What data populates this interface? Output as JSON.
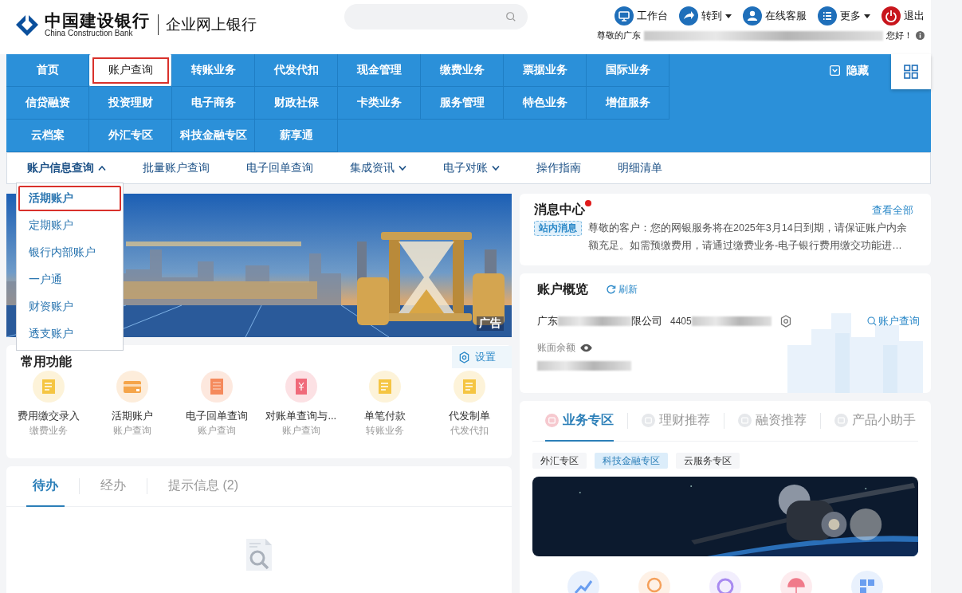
{
  "header": {
    "logo_cn": "中国建设银行",
    "logo_en": "China Construction Bank",
    "product": "企业网上银行",
    "toolbar": [
      {
        "label": "工作台",
        "kind": "monitor",
        "dropdown": false
      },
      {
        "label": "转到",
        "kind": "forward",
        "dropdown": true
      },
      {
        "label": "在线客服",
        "kind": "person",
        "dropdown": false
      },
      {
        "label": "更多",
        "kind": "list",
        "dropdown": true
      },
      {
        "label": "退出",
        "kind": "power",
        "dropdown": false
      }
    ],
    "greeting": {
      "prefix": "尊敬的广东",
      "suffix": "您好！"
    }
  },
  "main_nav": {
    "rows": [
      {
        "items": [
          {
            "label": "首页",
            "selected": false
          },
          {
            "label": "账户查询",
            "selected": true
          },
          {
            "label": "转账业务",
            "selected": false
          },
          {
            "label": "代发代扣",
            "selected": false
          },
          {
            "label": "现金管理",
            "selected": false
          },
          {
            "label": "缴费业务",
            "selected": false
          },
          {
            "label": "票据业务",
            "selected": false
          },
          {
            "label": "国际业务",
            "selected": false
          }
        ]
      },
      {
        "items": [
          {
            "label": "信贷融资",
            "selected": false
          },
          {
            "label": "投资理财",
            "selected": false
          },
          {
            "label": "电子商务",
            "selected": false
          },
          {
            "label": "财政社保",
            "selected": false
          },
          {
            "label": "卡类业务",
            "selected": false
          },
          {
            "label": "服务管理",
            "selected": false
          },
          {
            "label": "特色业务",
            "selected": false
          },
          {
            "label": "增值服务",
            "selected": false
          }
        ]
      },
      {
        "items": [
          {
            "label": "云档案",
            "selected": false
          },
          {
            "label": "外汇专区",
            "selected": false
          },
          {
            "label": "科技金融专区",
            "selected": false
          },
          {
            "label": "薪享通",
            "selected": false
          }
        ]
      }
    ],
    "hide_label": "隐藏"
  },
  "sub_nav": [
    {
      "label": "账户信息查询",
      "dropdown": true,
      "expanded": true
    },
    {
      "label": "批量账户查询",
      "dropdown": false
    },
    {
      "label": "电子回单查询",
      "dropdown": false
    },
    {
      "label": "集成资讯",
      "dropdown": true,
      "expanded": false
    },
    {
      "label": "电子对账",
      "dropdown": true,
      "expanded": false
    },
    {
      "label": "操作指南",
      "dropdown": false
    },
    {
      "label": "明细清单",
      "dropdown": false
    }
  ],
  "dropdown_menu": [
    {
      "label": "活期账户",
      "selected": true
    },
    {
      "label": "定期账户",
      "selected": false
    },
    {
      "label": "银行内部账户",
      "selected": false
    },
    {
      "label": "一户通",
      "selected": false
    },
    {
      "label": "财资账户",
      "selected": false
    },
    {
      "label": "透支账户",
      "selected": false
    }
  ],
  "banner": {
    "kind": "picture",
    "ad_label": "广告"
  },
  "common_functions": {
    "title": "常用功能",
    "settings_label": "设置",
    "items": [
      {
        "label": "费用缴交录入",
        "category": "缴费业务",
        "kind": "doc"
      },
      {
        "label": "活期账户",
        "category": "账户查询",
        "kind": "card"
      },
      {
        "label": "电子回单查询",
        "category": "账户查询",
        "kind": "receipt"
      },
      {
        "label": "对账单查询与...",
        "category": "账户查询",
        "kind": "bill"
      },
      {
        "label": "单笔付款",
        "category": "转账业务",
        "kind": "doc"
      },
      {
        "label": "代发制单",
        "category": "代发代扣",
        "kind": "doc"
      }
    ]
  },
  "tasks": {
    "tabs": [
      {
        "label": "待办",
        "selected": true
      },
      {
        "label": "经办",
        "selected": false
      },
      {
        "label": "提示信息 (2)",
        "selected": false
      }
    ]
  },
  "messages": {
    "title": "消息中心",
    "unread": true,
    "view_all": "查看全部",
    "tag": "站内消息",
    "text": "尊敬的客户：您的网银服务将在2025年3月14日到期，请保证账户内余额充足。如需预缴费用，请通过缴费业务-电子银行费用缴交功能进…"
  },
  "account_overview": {
    "title": "账户概览",
    "refresh": "刷新",
    "name_start": "广东",
    "name_end": "限公司",
    "number_start": "4405",
    "query_link": "账户查询",
    "balance_label": "账面余额"
  },
  "business": {
    "tabs": [
      {
        "label": "业务专区",
        "selected": true
      },
      {
        "label": "理财推荐",
        "selected": false
      },
      {
        "label": "融资推荐",
        "selected": false
      },
      {
        "label": "产品小助手",
        "selected": false
      }
    ],
    "chips": [
      {
        "label": "外汇专区",
        "selected": false
      },
      {
        "label": "科技金融专区",
        "selected": true
      },
      {
        "label": "云服务专区",
        "selected": false
      }
    ],
    "shortcuts": [
      {
        "kind": "chart"
      },
      {
        "kind": "coin"
      },
      {
        "kind": "ring"
      },
      {
        "kind": "umbrella"
      },
      {
        "kind": "grid"
      }
    ]
  }
}
